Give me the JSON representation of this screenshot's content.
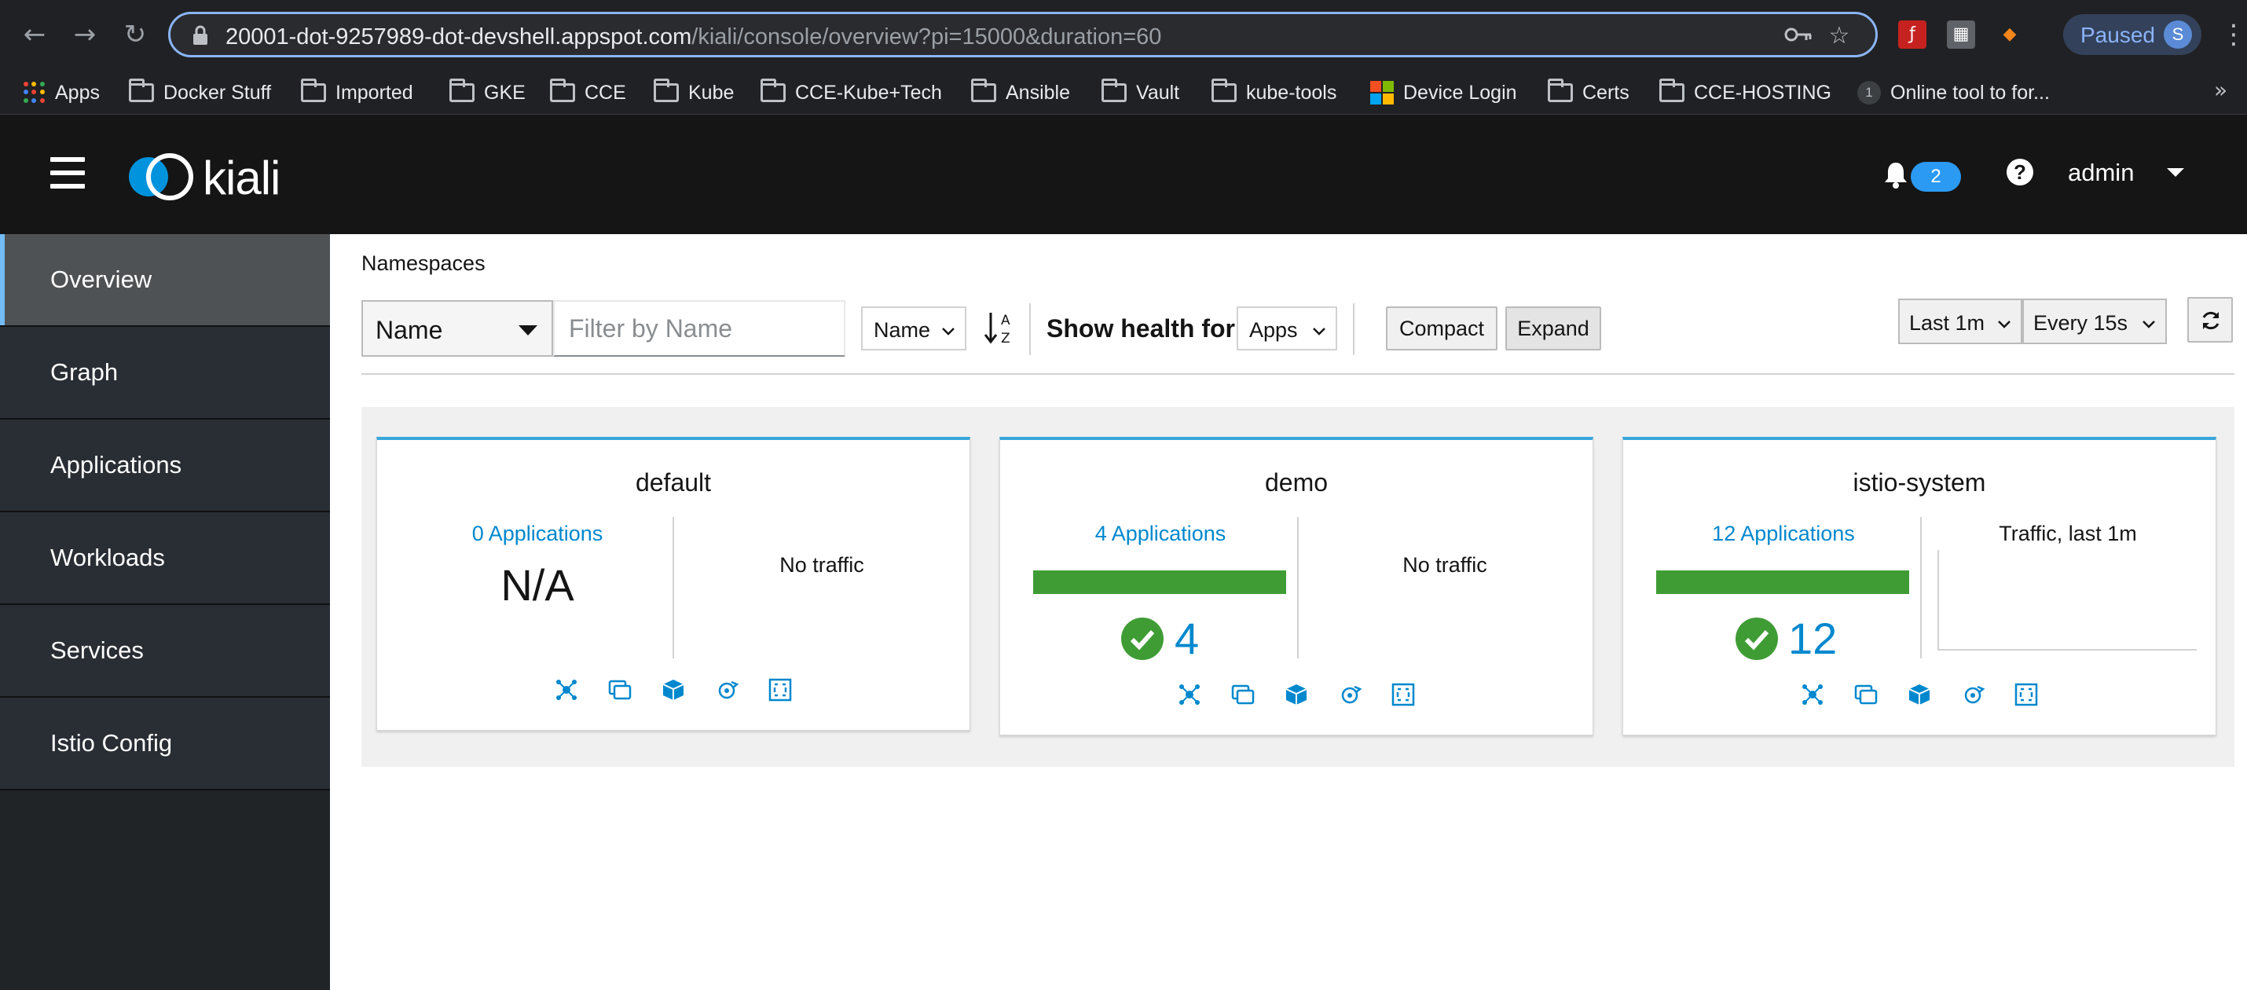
{
  "browser": {
    "url_host": "20001-dot-9257989-dot-devshell.appspot.com",
    "url_path": "/kiali/console/overview?pi=15000&duration=60",
    "paused_label": "Paused",
    "profile_initial": "S",
    "bookmarks": [
      {
        "label": "Apps",
        "icon": "apps-grid-icon"
      },
      {
        "label": "Docker Stuff",
        "icon": "folder-icon"
      },
      {
        "label": "Imported",
        "icon": "folder-icon"
      },
      {
        "label": "GKE",
        "icon": "folder-icon"
      },
      {
        "label": "CCE",
        "icon": "folder-icon"
      },
      {
        "label": "Kube",
        "icon": "folder-icon"
      },
      {
        "label": "CCE-Kube+Tech",
        "icon": "folder-icon"
      },
      {
        "label": "Ansible",
        "icon": "folder-icon"
      },
      {
        "label": "Vault",
        "icon": "folder-icon"
      },
      {
        "label": "kube-tools",
        "icon": "folder-icon"
      },
      {
        "label": "Device Login",
        "icon": "microsoft-logo-icon"
      },
      {
        "label": "Certs",
        "icon": "folder-icon"
      },
      {
        "label": "CCE-HOSTING",
        "icon": "folder-icon"
      },
      {
        "label": "Online tool to for...",
        "icon": "site-favicon-icon"
      }
    ]
  },
  "masthead": {
    "logo_text": "kiali",
    "notification_count": "2",
    "user": "admin"
  },
  "sidebar": {
    "items": [
      {
        "label": "Overview",
        "active": true
      },
      {
        "label": "Graph",
        "active": false
      },
      {
        "label": "Applications",
        "active": false
      },
      {
        "label": "Workloads",
        "active": false
      },
      {
        "label": "Services",
        "active": false
      },
      {
        "label": "Istio Config",
        "active": false
      }
    ]
  },
  "toolbar": {
    "page_title": "Namespaces",
    "filter_type": "Name",
    "filter_placeholder": "Filter by Name",
    "sort_field": "Name",
    "show_health_label": "Show health for",
    "health_type": "Apps",
    "compact_label": "Compact",
    "expand_label": "Expand",
    "duration": "Last 1m",
    "refresh_interval": "Every 15s"
  },
  "namespaces": [
    {
      "name": "default",
      "apps_link": "0 Applications",
      "status": "N/A",
      "traffic": "No traffic"
    },
    {
      "name": "demo",
      "apps_link": "4 Applications",
      "healthy_count": "4",
      "health_fraction": 1.0,
      "traffic": "No traffic"
    },
    {
      "name": "istio-system",
      "apps_link": "12 Applications",
      "healthy_count": "12",
      "health_fraction": 1.0,
      "traffic": "Traffic, last 1m"
    }
  ],
  "colors": {
    "masthead": "#151515",
    "sidebar": "#292e34",
    "active_accent": "#73bcf7",
    "link": "#0088ce",
    "healthy": "#3f9c35",
    "card_top_border": "#39a5dc"
  }
}
